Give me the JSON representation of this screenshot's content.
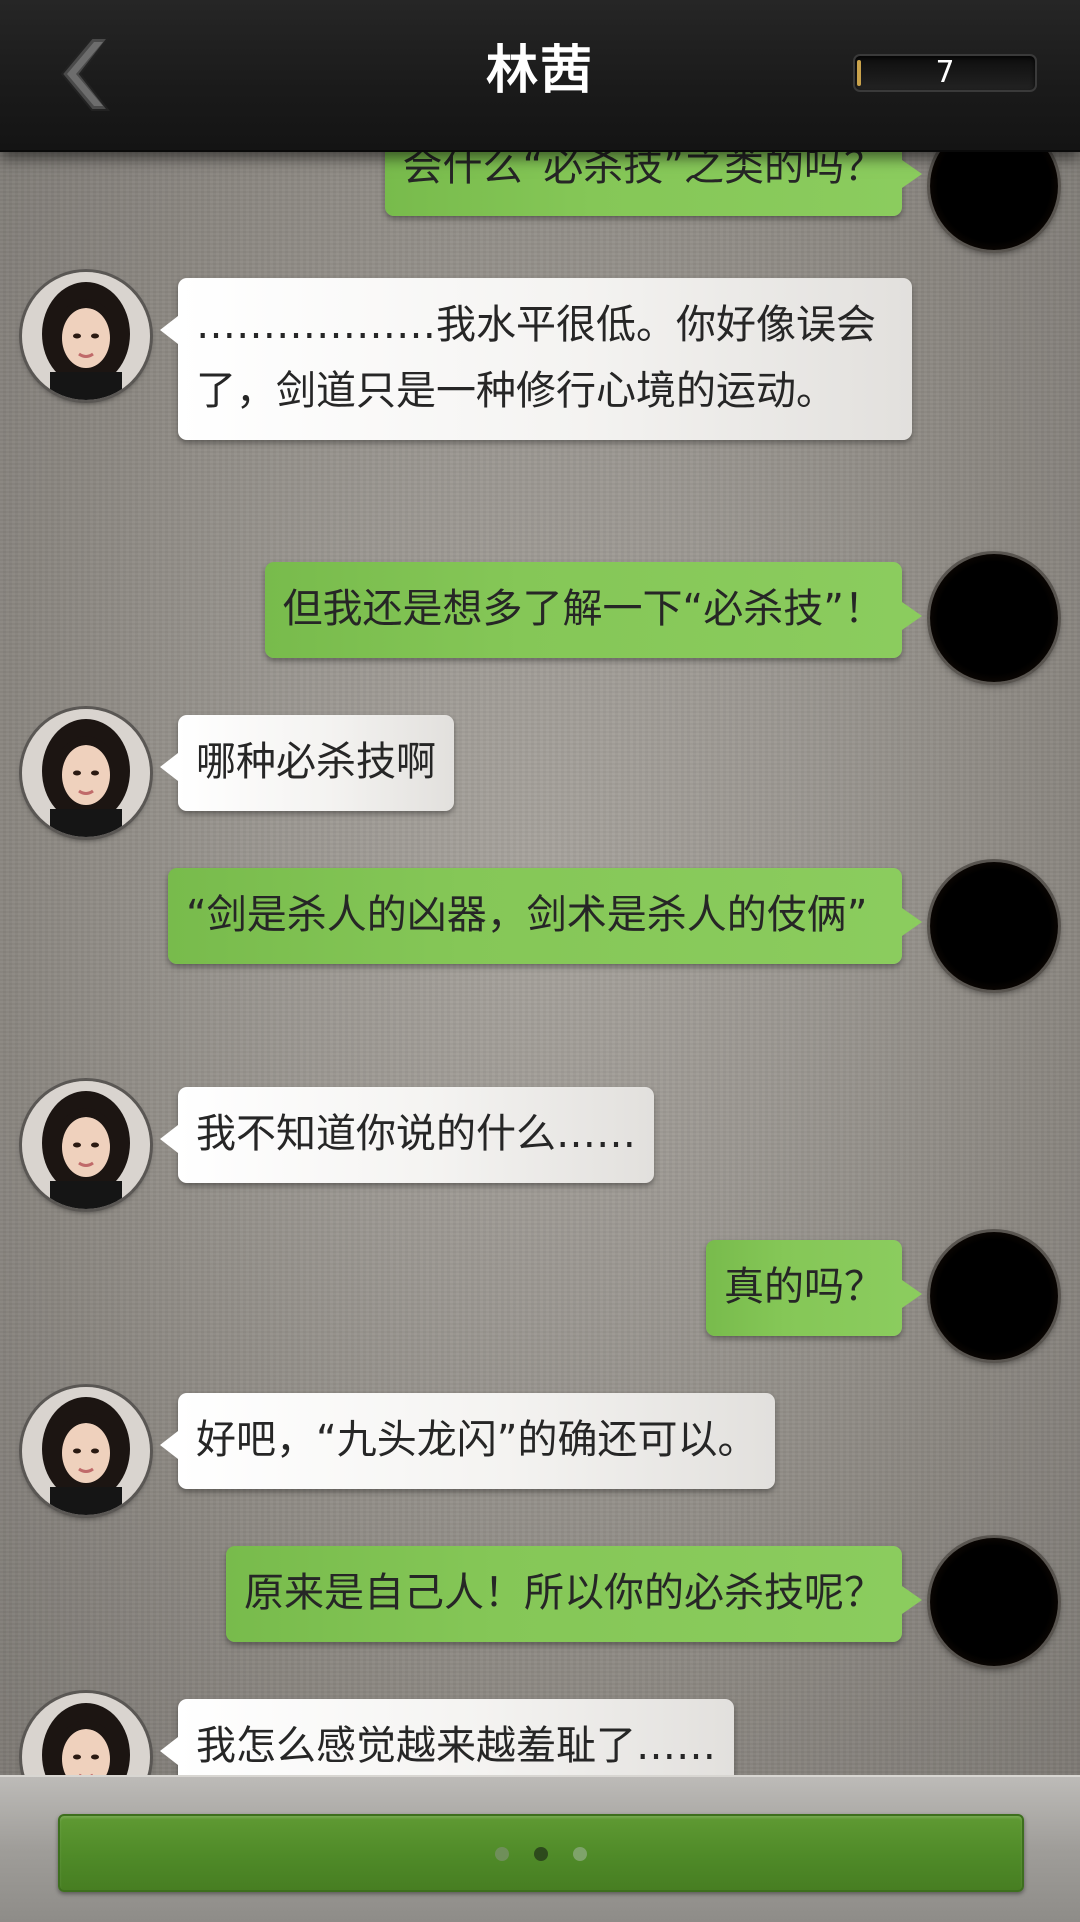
{
  "header": {
    "title": "林茜",
    "counter_value": "7",
    "back_icon": "chevron-left-icon"
  },
  "messages": [
    {
      "sender": "me",
      "text": "会什么“必杀技”之类的吗？"
    },
    {
      "sender": "her",
      "text": "………………我水平很低。你好像误会了，剑道只是一种修行心境的运动。"
    },
    {
      "sender": "me",
      "text": "但我还是想多了解一下“必杀技”！"
    },
    {
      "sender": "her",
      "text": "哪种必杀技啊"
    },
    {
      "sender": "me",
      "text": "“剑是杀人的凶器，剑术是杀人的伎俩”"
    },
    {
      "sender": "her",
      "text": "我不知道你说的什么……"
    },
    {
      "sender": "me",
      "text": "真的吗？"
    },
    {
      "sender": "her",
      "text": "好吧，“九头龙闪”的确还可以。"
    },
    {
      "sender": "me",
      "text": "原来是自己人！所以你的必杀技呢？"
    },
    {
      "sender": "her",
      "text": "我怎么感觉越来越羞耻了……"
    }
  ],
  "input": {
    "typing_indicator": "typing-dots-icon"
  },
  "colors": {
    "my_bubble": "#85c757",
    "her_bubble": "#f4f3f1",
    "topbar": "#1a1a1a",
    "input_bar": "#4f8a28"
  }
}
